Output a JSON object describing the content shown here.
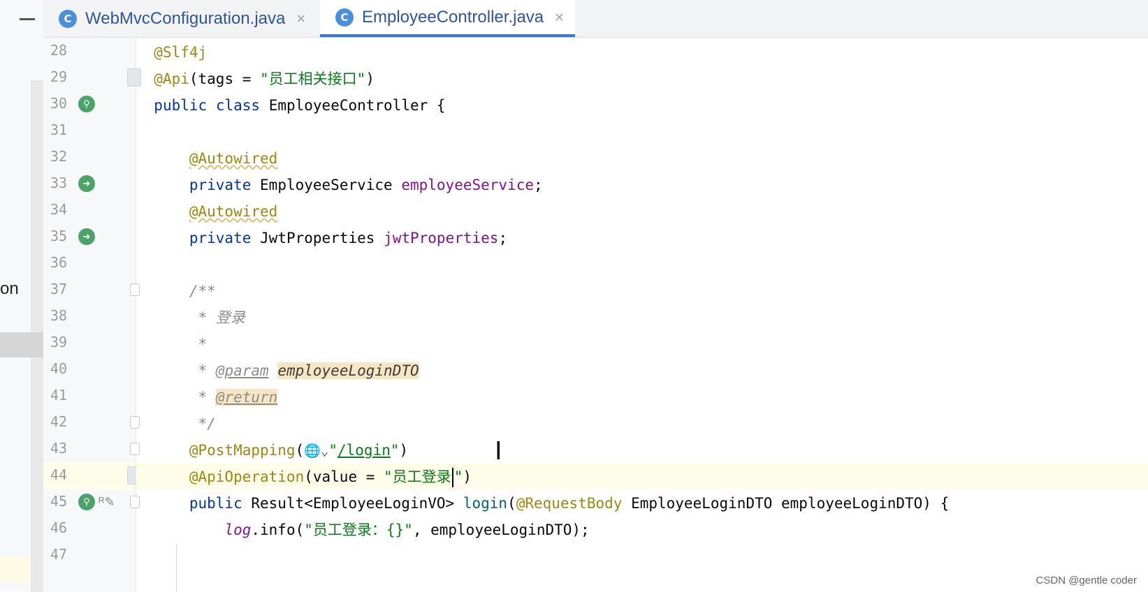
{
  "left_panel": {
    "partial_label": "on"
  },
  "tabs": [
    {
      "icon": "C",
      "title": "WebMvcConfiguration.java",
      "close": "×"
    },
    {
      "icon": "C",
      "title": "EmployeeController.java",
      "close": "×"
    }
  ],
  "line_numbers": [
    "28",
    "29",
    "30",
    "31",
    "32",
    "33",
    "34",
    "35",
    "36",
    "37",
    "38",
    "39",
    "40",
    "41",
    "42",
    "43",
    "44",
    "45",
    "46",
    "47"
  ],
  "code": {
    "l28": {
      "annotation": "@Slf4j"
    },
    "l29": {
      "annotation": "@Api",
      "text1": "(tags = ",
      "string": "\"员工相关接口\"",
      "text2": ")"
    },
    "l30": {
      "kw1": "public",
      "kw2": "class",
      "text": "EmployeeController {"
    },
    "l32": {
      "annotation": "@Autowired"
    },
    "l33": {
      "kw": "private",
      "type": "EmployeeService",
      "field": "employeeService",
      "semi": ";"
    },
    "l34": {
      "annotation": "@Autowired"
    },
    "l35": {
      "kw": "private",
      "type": "JwtProperties",
      "field": "jwtProperties",
      "semi": ";"
    },
    "l37": {
      "comment": "/**"
    },
    "l38": {
      "comment": "* 登录"
    },
    "l39": {
      "comment": "*"
    },
    "l40": {
      "star": "* ",
      "tag": "@param",
      "param": "employeeLoginDTO"
    },
    "l41": {
      "star": "* ",
      "tag": "@return"
    },
    "l42": {
      "comment": "*/"
    },
    "l43": {
      "annotation": "@PostMapping",
      "open": "(",
      "globe": "🌐⌄",
      "q1": "\"",
      "url": "/login",
      "q2": "\"",
      "close": ")"
    },
    "l44": {
      "annotation": "@ApiOperation",
      "text1": "(value = ",
      "string_before_caret": "\"员工登录",
      "string_after_caret": "\"",
      "text2": ")"
    },
    "l45": {
      "kw": "public",
      "type": "Result<EmployeeLoginVO>",
      "method": "login",
      "open": "(",
      "param_annotation": "@RequestBody",
      "rest": "EmployeeLoginDTO employeeLoginDTO) {"
    },
    "l46": {
      "log": "log",
      "text1": ".info(",
      "string": "\"员工登录：{}\"",
      "text2": ", employeeLoginDTO);"
    }
  },
  "gutter_icons": {
    "l30": "bean-search-icon",
    "l33": "bean-navigate-icon",
    "l35": "bean-navigate-icon",
    "l45": "endpoint-icon"
  },
  "watermark": "CSDN @gentle coder"
}
